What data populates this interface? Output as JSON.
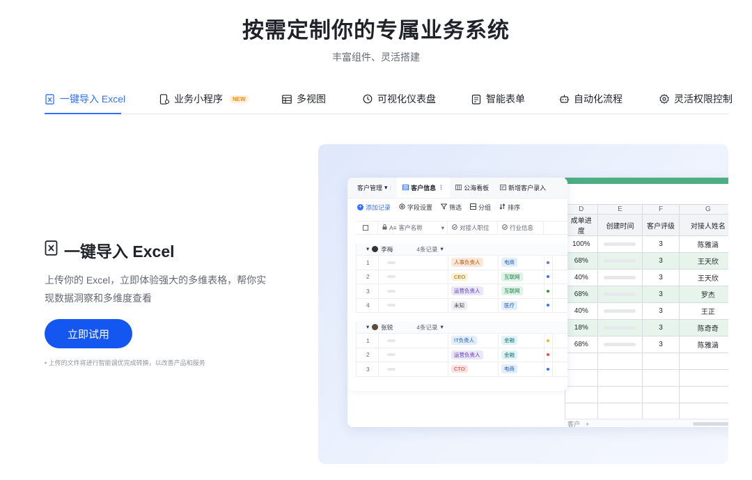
{
  "hero": {
    "title": "按需定制你的专属业务系统",
    "subtitle": "丰富组件、灵活搭建"
  },
  "tabs": [
    {
      "label": "一键导入 Excel",
      "icon": "excel-file-icon",
      "active": true
    },
    {
      "label": "业务小程序",
      "icon": "mini-app-icon",
      "badge": "NEW"
    },
    {
      "label": "多视图",
      "icon": "table-view-icon"
    },
    {
      "label": "可视化仪表盘",
      "icon": "dashboard-gauge-icon"
    },
    {
      "label": "智能表单",
      "icon": "form-icon"
    },
    {
      "label": "自动化流程",
      "icon": "automation-icon"
    },
    {
      "label": "灵活权限控制",
      "icon": "gear-icon"
    }
  ],
  "feature": {
    "title": "一键导入 Excel",
    "description": "上传你的 Excel，立即体验强大的多维表格，帮你实现数据洞察和多维度查看",
    "button": "立即试用",
    "notice": "• 上传的文件将进行智能调优完成转换，以改善产品和服务"
  },
  "preview": {
    "base_tabs": {
      "folder": "客户管理",
      "folder_arrow": "▾",
      "breadcrumb_sep": "/",
      "active": "客户信息",
      "more": "⋮",
      "tab2": "公海看板",
      "tab3": "新增客户录入"
    },
    "toolbar": {
      "add": "添加记录",
      "fields": "字段设置",
      "filter": "筛选",
      "group": "分组",
      "sort": "排序"
    },
    "columns": {
      "name": "客户名称",
      "role": "对接人职位",
      "industry": "行业信息"
    },
    "groups": [
      {
        "owner": "李梅",
        "count": "4条记录",
        "rows": [
          {
            "n": "1",
            "role": "人事负责人",
            "role_color": "orange",
            "industry": "电商",
            "ind_color": "blue",
            "dot": "#8a5cf5"
          },
          {
            "n": "2",
            "role": "CEO",
            "role_color": "yellow",
            "industry": "互联网",
            "ind_color": "green",
            "dot": "#3370ff"
          },
          {
            "n": "3",
            "role": "运营负责人",
            "role_color": "purple",
            "industry": "互联网",
            "ind_color": "green",
            "dot": "#2ea121"
          },
          {
            "n": "4",
            "role": "未知",
            "role_color": "grey",
            "industry": "医疗",
            "ind_color": "blue",
            "dot": "#3370ff"
          }
        ]
      },
      {
        "owner": "张锐",
        "count": "4条记录",
        "rows": [
          {
            "n": "1",
            "role": "IT负责人",
            "role_color": "blue",
            "industry": "金融",
            "ind_color": "teal",
            "dot": "#f5b80b"
          },
          {
            "n": "2",
            "role": "运营负责人",
            "role_color": "purple",
            "industry": "金融",
            "ind_color": "teal",
            "dot": "#f54a45"
          },
          {
            "n": "3",
            "role": "CTO",
            "role_color": "red",
            "industry": "电商",
            "ind_color": "blue",
            "dot": "#3370ff"
          }
        ]
      }
    ],
    "excel": {
      "col_letters": [
        "D",
        "E",
        "F",
        "G"
      ],
      "headers": [
        "成单进度",
        "创建时间",
        "客户评级",
        "对接人姓名"
      ],
      "rows": [
        {
          "progress": "100%",
          "rating": "3",
          "contact": "陈雅涵",
          "highlight": false
        },
        {
          "progress": "68%",
          "rating": "3",
          "contact": "王天欣",
          "highlight": true
        },
        {
          "progress": "40%",
          "rating": "3",
          "contact": "王天欣",
          "highlight": false
        },
        {
          "progress": "68%",
          "rating": "3",
          "contact": "罗杰",
          "highlight": true
        },
        {
          "progress": "40%",
          "rating": "3",
          "contact": "王正",
          "highlight": false
        },
        {
          "progress": "18%",
          "rating": "3",
          "contact": "陈奇奇",
          "highlight": true
        },
        {
          "progress": "68%",
          "rating": "3",
          "contact": "陈雅涵",
          "highlight": false
        }
      ],
      "sheet_tab": "客户",
      "add_sheet": "+"
    }
  },
  "colors": {
    "accent": "#3370ff",
    "button": "#1456f0",
    "excel_green": "#4cae82"
  }
}
